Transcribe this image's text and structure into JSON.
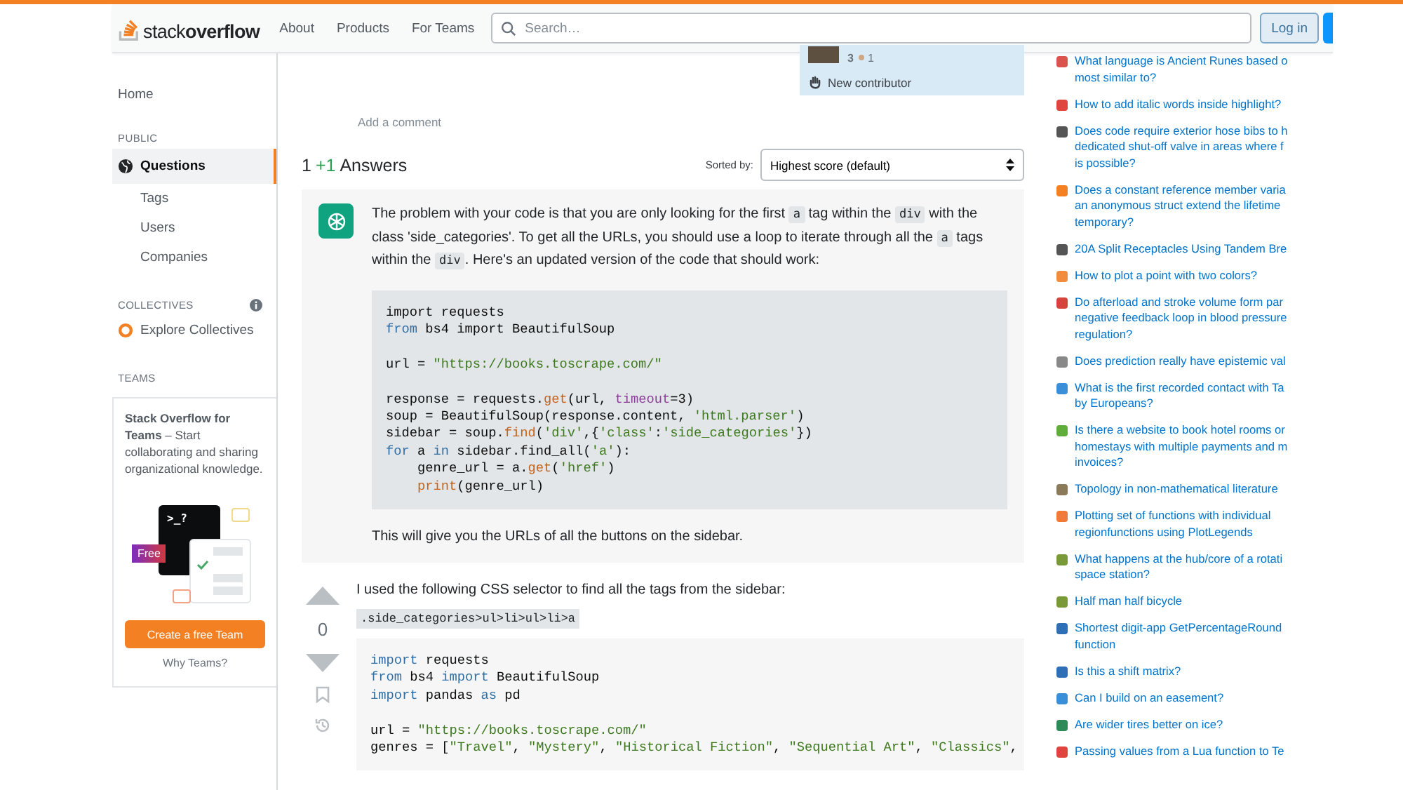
{
  "header": {
    "logo": "stack**overflow**",
    "nav": [
      "About",
      "Products",
      "For Teams"
    ],
    "search": {
      "placeholder": "Search…"
    },
    "login": "Log in"
  },
  "sidebar": {
    "home": "Home",
    "sections": [
      {
        "heading": "PUBLIC",
        "kind": "nav",
        "items": [
          {
            "kind": "globe",
            "label": "Questions",
            "selected": true
          },
          {
            "kind": "text",
            "label": "Tags",
            "selected": false
          },
          {
            "kind": "text",
            "label": "Users",
            "selected": false
          },
          {
            "kind": "text",
            "label": "Companies",
            "selected": false
          }
        ]
      },
      {
        "heading": "COLLECTIVES",
        "kind": "collectives",
        "items": [
          {
            "kind": "collective",
            "label": "Explore Collectives",
            "selected": false
          }
        ]
      },
      {
        "heading": "TEAMS",
        "kind": "teams"
      }
    ],
    "teams": {
      "text": "**Stack Overflow for Teams** – Start collaborating and sharing organizational knowledge.",
      "prompt": ">_?",
      "tag": "Free",
      "button": "Create a free Team",
      "link": "Why Teams?"
    }
  },
  "user_card": {
    "reputation": "3",
    "bronze": "1",
    "new_contributor": "New contributor"
  },
  "add_comment": "Add a comment",
  "answers_header": {
    "count": "1",
    "delta": "+1",
    "label": "Answers",
    "sort_label": "Sorted by:",
    "sort_value": "Highest score (default)"
  },
  "answers": [
    {
      "kind": "bot",
      "paragraph": [
        {
          "kind": "text",
          "text": "The problem with your code is that you are only looking for the first "
        },
        {
          "kind": "code",
          "text": "a"
        },
        {
          "kind": "text",
          "text": " tag within the "
        },
        {
          "kind": "code",
          "text": "div"
        },
        {
          "kind": "text",
          "text": " with the class 'side_categories'. To get all the URLs, you should use a loop to iterate through all the "
        },
        {
          "kind": "code",
          "text": "a"
        },
        {
          "kind": "text",
          "text": " tags within the "
        },
        {
          "kind": "code",
          "text": "div"
        },
        {
          "kind": "text",
          "text": ". Here's an updated version of the code that should work:"
        }
      ],
      "code": [
        {
          "kind": "code",
          "tokens": [
            {
              "kind": "plain",
              "text": "import requests"
            }
          ]
        },
        {
          "kind": "code",
          "tokens": [
            {
              "kind": "kw",
              "text": "from"
            },
            {
              "kind": "plain",
              "text": " bs4 import BeautifulSoup"
            }
          ]
        },
        {
          "kind": "blank"
        },
        {
          "kind": "code",
          "tokens": [
            {
              "kind": "plain",
              "text": "url = "
            },
            {
              "kind": "str",
              "text": "\"https://books.toscrape.com/\""
            }
          ]
        },
        {
          "kind": "blank"
        },
        {
          "kind": "code",
          "tokens": [
            {
              "kind": "plain",
              "text": "response = requests."
            },
            {
              "kind": "fn",
              "text": "get"
            },
            {
              "kind": "plain",
              "text": "(url, "
            },
            {
              "kind": "param",
              "text": "timeout"
            },
            {
              "kind": "plain",
              "text": "=3)"
            }
          ]
        },
        {
          "kind": "code",
          "tokens": [
            {
              "kind": "plain",
              "text": "soup = BeautifulSoup(response.content, "
            },
            {
              "kind": "str",
              "text": "'html.parser'"
            },
            {
              "kind": "plain",
              "text": ")"
            }
          ]
        },
        {
          "kind": "code",
          "tokens": [
            {
              "kind": "plain",
              "text": "sidebar = soup."
            },
            {
              "kind": "fn",
              "text": "find"
            },
            {
              "kind": "plain",
              "text": "("
            },
            {
              "kind": "str",
              "text": "'div'"
            },
            {
              "kind": "plain",
              "text": ",{"
            },
            {
              "kind": "str",
              "text": "'class'"
            },
            {
              "kind": "plain",
              "text": ":"
            },
            {
              "kind": "str",
              "text": "'side_categories'"
            },
            {
              "kind": "plain",
              "text": "})"
            }
          ]
        },
        {
          "kind": "code",
          "tokens": [
            {
              "kind": "kw",
              "text": "for"
            },
            {
              "kind": "plain",
              "text": " a "
            },
            {
              "kind": "kw",
              "text": "in"
            },
            {
              "kind": "plain",
              "text": " sidebar.find_all("
            },
            {
              "kind": "str",
              "text": "'a'"
            },
            {
              "kind": "plain",
              "text": "):"
            }
          ]
        },
        {
          "kind": "code",
          "tokens": [
            {
              "kind": "plain",
              "text": "    genre_url = a."
            },
            {
              "kind": "fn",
              "text": "get"
            },
            {
              "kind": "plain",
              "text": "("
            },
            {
              "kind": "str",
              "text": "'href'"
            },
            {
              "kind": "plain",
              "text": ")"
            }
          ]
        },
        {
          "kind": "code",
          "tokens": [
            {
              "kind": "fn",
              "text": "    print"
            },
            {
              "kind": "plain",
              "text": "(genre_url)"
            }
          ]
        }
      ],
      "after": "This will give you the URLs of all the buttons on the sidebar."
    },
    {
      "kind": "user",
      "score": "0",
      "text": "I used the following CSS selector to find all the tags from the sidebar:",
      "inline_code": ".side_categories>ul>li>ul>li>a",
      "code": [
        {
          "kind": "code",
          "tokens": [
            {
              "kind": "kw",
              "text": "import"
            },
            {
              "kind": "plain",
              "text": " requests"
            }
          ]
        },
        {
          "kind": "code",
          "tokens": [
            {
              "kind": "kw",
              "text": "from"
            },
            {
              "kind": "plain",
              "text": " bs4 "
            },
            {
              "kind": "kw",
              "text": "import"
            },
            {
              "kind": "plain",
              "text": " BeautifulSoup"
            }
          ]
        },
        {
          "kind": "code",
          "tokens": [
            {
              "kind": "kw",
              "text": "import"
            },
            {
              "kind": "plain",
              "text": " pandas "
            },
            {
              "kind": "kw",
              "text": "as"
            },
            {
              "kind": "plain",
              "text": " pd"
            }
          ]
        },
        {
          "kind": "blank"
        },
        {
          "kind": "code",
          "tokens": [
            {
              "kind": "plain",
              "text": "url = "
            },
            {
              "kind": "str",
              "text": "\"https://books.toscrape.com/\""
            }
          ]
        },
        {
          "kind": "code",
          "tokens": [
            {
              "kind": "plain",
              "text": "genres = ["
            },
            {
              "kind": "str",
              "text": "\"Travel\""
            },
            {
              "kind": "plain",
              "text": ", "
            },
            {
              "kind": "str",
              "text": "\"Mystery\""
            },
            {
              "kind": "plain",
              "text": ", "
            },
            {
              "kind": "str",
              "text": "\"Historical Fiction\""
            },
            {
              "kind": "plain",
              "text": ", "
            },
            {
              "kind": "str",
              "text": "\"Sequential Art\""
            },
            {
              "kind": "plain",
              "text": ", "
            },
            {
              "kind": "str",
              "text": "\"Classics\""
            },
            {
              "kind": "plain",
              "text": ","
            }
          ]
        }
      ]
    }
  ],
  "hot_questions": [
    {
      "color": "#d9534f",
      "lines": [
        "What language is Ancient Runes based o",
        "most similar to?"
      ]
    },
    {
      "color": "#e0443e",
      "lines": [
        "How to add italic words inside highlight?"
      ]
    },
    {
      "color": "#555555",
      "lines": [
        "Does code require exterior hose bibs to h",
        "dedicated shut-off valve in areas where f",
        "is possible?"
      ]
    },
    {
      "color": "#f48024",
      "lines": [
        "Does a constant reference member varia",
        "an anonymous struct extend the lifetime",
        "temporary?"
      ]
    },
    {
      "color": "#555555",
      "lines": [
        "20A Split Receptacles Using Tandem Bre"
      ]
    },
    {
      "color": "#f08c3c",
      "lines": [
        "How to plot a point with two colors?"
      ]
    },
    {
      "color": "#d6453d",
      "lines": [
        "Do afterload and stroke volume form par",
        "negative feedback loop in blood pressure",
        "regulation?"
      ]
    },
    {
      "color": "#888888",
      "lines": [
        "Does prediction really have epistemic val"
      ]
    },
    {
      "color": "#3b8fd9",
      "lines": [
        "What is the first recorded contact with Ta",
        "by Europeans?"
      ]
    },
    {
      "color": "#5fae3c",
      "lines": [
        "Is there a website to book hotel rooms or",
        "homestays with multiple payments and m",
        "invoices?"
      ]
    },
    {
      "color": "#8a7a5a",
      "lines": [
        "Topology in non-mathematical literature"
      ]
    },
    {
      "color": "#f07a3a",
      "lines": [
        "Plotting set of functions with individual",
        "regionfunctions using PlotLegends"
      ]
    },
    {
      "color": "#7a9a3a",
      "lines": [
        "What happens at the hub/core of a rotati",
        "space station?"
      ]
    },
    {
      "color": "#7a9a3a",
      "lines": [
        "Half man half bicycle"
      ]
    },
    {
      "color": "#2f6fb5",
      "lines": [
        "Shortest digit-app GetPercentageRound",
        "function"
      ]
    },
    {
      "color": "#2f6fb5",
      "lines": [
        "Is this a shift matrix?"
      ]
    },
    {
      "color": "#3b8fd9",
      "lines": [
        "Can I build on an easement?"
      ]
    },
    {
      "color": "#2e8b57",
      "lines": [
        "Are wider tires better on ice?"
      ]
    },
    {
      "color": "#e0443e",
      "lines": [
        "Passing values from a Lua function to Te"
      ]
    }
  ]
}
